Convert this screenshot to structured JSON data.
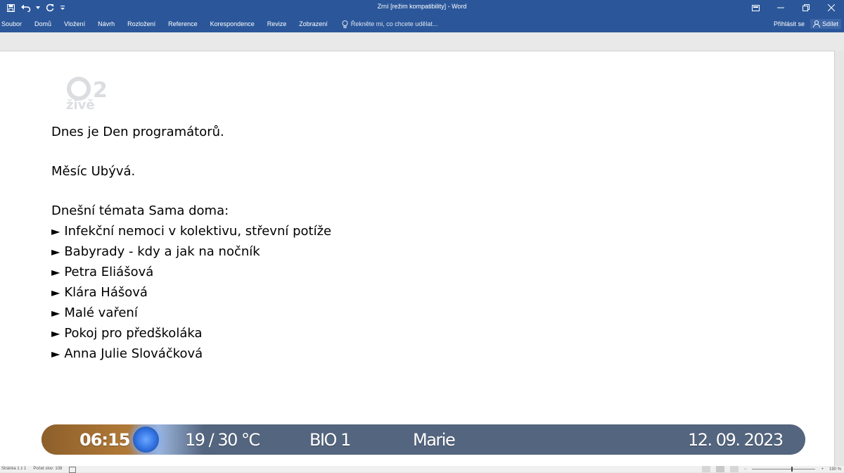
{
  "window": {
    "title": "Zrní [režim kompatibility] - Word",
    "qat_icons": [
      "save-icon",
      "undo-icon",
      "redo-icon",
      "customize-icon"
    ],
    "controls": [
      "ribbon-display-options-icon",
      "minimize-icon",
      "restore-icon",
      "close-icon"
    ]
  },
  "ribbon": {
    "tabs": [
      "Soubor",
      "Domů",
      "Vložení",
      "Návrh",
      "Rozložení",
      "Reference",
      "Korespondence",
      "Revize",
      "Zobrazení"
    ],
    "tell_me": "Řekněte mi, co chcete udělat...",
    "sign_in": "Přihlásit se",
    "share": "Sdílet"
  },
  "watermark": {
    "channel": "2",
    "live": "živě"
  },
  "document": {
    "line1": "Dnes je Den programátorů.",
    "line2": "Měsíc Ubývá.",
    "line3": "Dnešní témata Sama doma:",
    "bullet_glyph": "►",
    "bullets": [
      "Infekční nemoci v kolektivu, střevní potíže",
      "Babyrady - kdy a jak na nočník",
      "Petra Eliášová",
      "Klára Hášová",
      "Malé vaření",
      "Pokoj pro předškoláka",
      "Anna Julie Slováčková"
    ]
  },
  "tvbar": {
    "time": "06:15",
    "temp": "19 / 30 °C",
    "bio": "BIO 1",
    "name_day": "Marie",
    "date": "12. 09. 2023"
  },
  "statusbar": {
    "page": "Stránka 1 z 1",
    "words": "Počet slov: 108",
    "zoom": "190 %"
  },
  "colors": {
    "ribbon": "#2b579a",
    "tvbar": "#54657f"
  }
}
